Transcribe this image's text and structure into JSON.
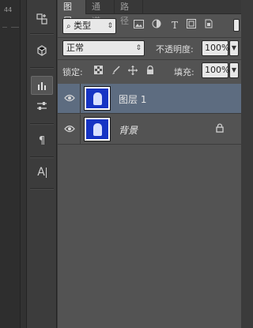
{
  "ruler": {
    "label": "44"
  },
  "tabs": [
    {
      "label": "图层",
      "active": true
    },
    {
      "label": "通道",
      "active": false
    },
    {
      "label": "路径",
      "active": false
    }
  ],
  "filter": {
    "search_icon": "ρ",
    "kind_label": "类型"
  },
  "filter_icons": [
    "image-filter-icon",
    "adjustment-filter-icon",
    "type-filter-icon",
    "shape-filter-icon",
    "smartobject-filter-icon"
  ],
  "blend": {
    "mode": "正常",
    "opacity_label": "不透明度:",
    "opacity_value": "100%"
  },
  "lock": {
    "label": "锁定:",
    "fill_label": "填充:",
    "fill_value": "100%"
  },
  "layers": [
    {
      "name": "图层 1",
      "selected": true,
      "visible": true,
      "locked": false
    },
    {
      "name": "背景",
      "selected": false,
      "visible": true,
      "locked": true
    }
  ],
  "colors": {
    "selected_row": "#5d6c80",
    "thumb_blue": "#1634c4"
  }
}
